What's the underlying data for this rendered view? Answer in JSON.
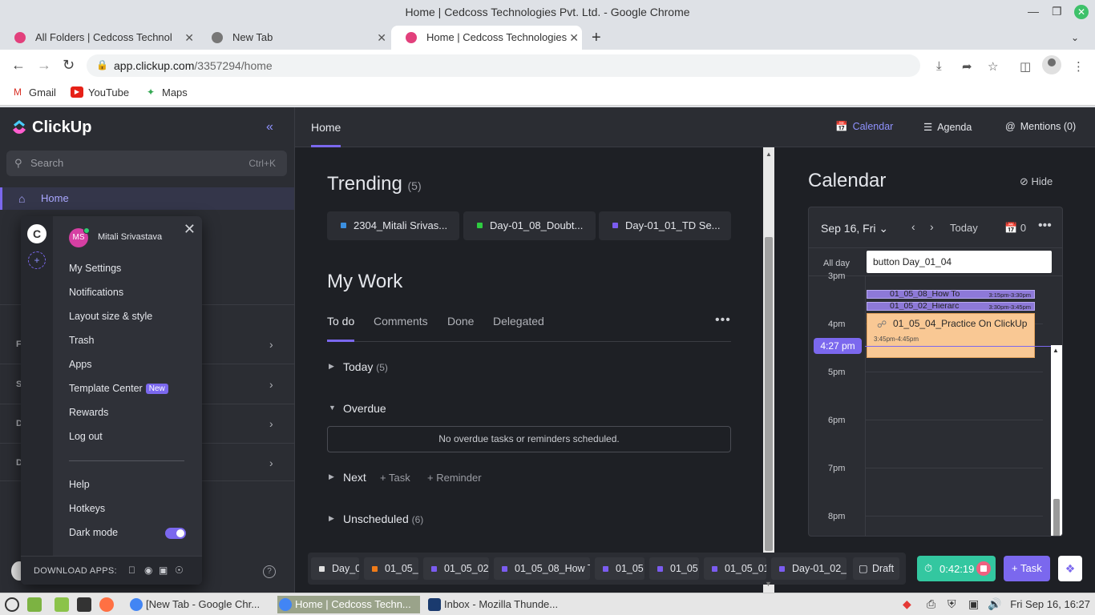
{
  "window": {
    "title": "Home | Cedcoss Technologies Pvt. Ltd. - Google Chrome"
  },
  "tabs": [
    {
      "label": "All Folders | Cedcoss Technol"
    },
    {
      "label": "New Tab"
    },
    {
      "label": "Home | Cedcoss Technologies"
    }
  ],
  "address_bar": {
    "host": "app.clickup.com",
    "path": "/3357294/home"
  },
  "bookmarks": [
    {
      "label": "Gmail"
    },
    {
      "label": "YouTube"
    },
    {
      "label": "Maps"
    }
  ],
  "sidebar": {
    "brand": "ClickUp",
    "search_placeholder": "Search",
    "search_shortcut": "Ctrl+K",
    "home_label": "Home",
    "section_letters": [
      "F",
      "S",
      "D",
      "D"
    ]
  },
  "profile_menu": {
    "workspace_initial": "C",
    "user_initials": "MS",
    "user_name": "Mitali Srivastava",
    "items": [
      "My Settings",
      "Notifications",
      "Layout size & style",
      "Trash",
      "Apps",
      "Template Center",
      "Rewards",
      "Log out"
    ],
    "template_badge": "New",
    "items2": [
      "Help",
      "Hotkeys",
      "Dark mode"
    ],
    "download_label": "DOWNLOAD APPS:"
  },
  "header": {
    "home_tab": "Home",
    "calendar_btn": "Calendar",
    "agenda_btn": "Agenda",
    "mentions_btn": "Mentions (0)"
  },
  "trending": {
    "title": "Trending",
    "count": "(5)",
    "cards": [
      {
        "label": "2304_Mitali Srivas...",
        "color": "#3b8fe0"
      },
      {
        "label": "Day-01_08_Doubt...",
        "color": "#2ecc40"
      },
      {
        "label": "Day-01_01_TD Se...",
        "color": "#7b5cf0"
      }
    ]
  },
  "my_work": {
    "title": "My Work",
    "tabs": [
      "To do",
      "Comments",
      "Done",
      "Delegated"
    ],
    "groups": {
      "today": {
        "label": "Today",
        "count": "(5)"
      },
      "overdue": {
        "label": "Overdue"
      },
      "empty_message": "No overdue tasks or reminders scheduled.",
      "next": {
        "label": "Next",
        "add_task": "+ Task",
        "add_reminder": "+ Reminder"
      },
      "unscheduled": {
        "label": "Unscheduled",
        "count": "(6)"
      }
    }
  },
  "calendar": {
    "title": "Calendar",
    "hide_label": "Hide",
    "date": "Sep 16, Fri",
    "today_label": "Today",
    "event_count": "0",
    "allday_label": "All day",
    "allday_event": "button Day_01_04",
    "hours": [
      "3pm",
      "4pm",
      "5pm",
      "6pm",
      "7pm",
      "8pm"
    ],
    "now_label": "4:27 pm",
    "events": [
      {
        "title": "01_05_08_How To",
        "time": "3:15pm-3:30pm"
      },
      {
        "title": "01_05_02_Hierarc",
        "time": "3:30pm-3:45pm"
      },
      {
        "title": "01_05_04_Practice On ClickUp",
        "time": "3:45pm-4:45pm"
      }
    ]
  },
  "task_tray": {
    "chips": [
      {
        "label": "Day_0",
        "color": "#e0e0e0"
      },
      {
        "label": "01_05_",
        "color": "#f07b18"
      },
      {
        "label": "01_05_02",
        "color": "#7b5cf0"
      },
      {
        "label": "01_05_08_How T",
        "color": "#7b5cf0"
      },
      {
        "label": "01_05",
        "color": "#7b5cf0"
      },
      {
        "label": "01_05",
        "color": "#7b5cf0"
      },
      {
        "label": "01_05_01",
        "color": "#7b5cf0"
      },
      {
        "label": "Day-01_02_C",
        "color": "#7b5cf0"
      }
    ],
    "draft_label": "Draft",
    "timer_value": "0:42:19",
    "task_btn": "Task"
  },
  "taskbar": {
    "apps": [
      "[New Tab - Google Chr...",
      "Home | Cedcoss Techn...",
      "Inbox - Mozilla Thunde..."
    ],
    "clock": "Fri Sep 16, 16:27"
  },
  "colors": {
    "accent": "#7b68ee",
    "timer": "#33c7a0",
    "event_orange": "#f9c894",
    "event_purple": "#8d79d8"
  }
}
